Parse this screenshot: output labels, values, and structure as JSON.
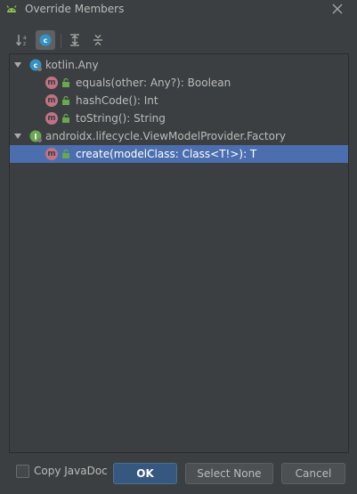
{
  "window": {
    "title": "Override Members",
    "app_icon": "android-icon",
    "close_icon": "close-icon"
  },
  "toolbar": {
    "buttons": [
      {
        "icon": "sort-alphabetically-icon",
        "active": false
      },
      {
        "icon": "show-classes-icon",
        "active": true
      },
      {
        "icon": "expand-all-icon",
        "active": false
      },
      {
        "icon": "collapse-all-icon",
        "active": false
      }
    ]
  },
  "tree": {
    "nodes": [
      {
        "type": "class",
        "label": "kotlin.Any",
        "expanded": true,
        "icon": "class-icon"
      },
      {
        "type": "method",
        "label": "equals(other: Any?): Boolean",
        "icon": "method-icon",
        "badge": "m"
      },
      {
        "type": "method",
        "label": "hashCode(): Int",
        "icon": "method-icon",
        "badge": "m"
      },
      {
        "type": "method",
        "label": "toString(): String",
        "icon": "method-icon",
        "badge": "m"
      },
      {
        "type": "interface",
        "label": "androidx.lifecycle.ViewModelProvider.Factory",
        "expanded": true,
        "icon": "interface-icon"
      },
      {
        "type": "method",
        "label": "create(modelClass: Class<T!>): T",
        "icon": "method-icon",
        "badge": "m",
        "selected": true
      }
    ]
  },
  "footer": {
    "copy_javadoc_label": "Copy JavaDoc",
    "copy_javadoc_checked": false,
    "ok_label": "OK",
    "select_none_label": "Select None",
    "cancel_label": "Cancel"
  },
  "colors": {
    "background": "#3c3f41",
    "selection": "#4b6eaf",
    "method_badge": "#c07384",
    "primary_button": "#365880"
  }
}
